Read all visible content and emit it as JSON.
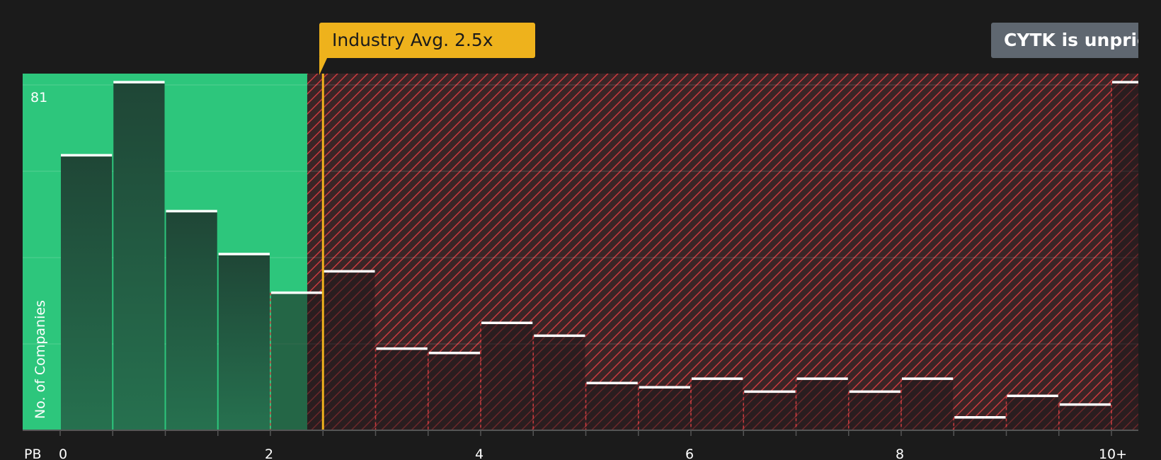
{
  "chart_data": {
    "type": "bar",
    "x_axis_label": "PB",
    "y_axis_label": "No. of Companies",
    "y_max_label": "81",
    "ylim": [
      0,
      83
    ],
    "grid": true,
    "x_tick_labels": [
      "0",
      "2",
      "4",
      "6",
      "8",
      "10+"
    ],
    "bin_width": 0.5,
    "bins": [
      {
        "x_start": 0.0,
        "value": 64
      },
      {
        "x_start": 0.5,
        "value": 81
      },
      {
        "x_start": 1.0,
        "value": 51
      },
      {
        "x_start": 1.5,
        "value": 41
      },
      {
        "x_start": 2.0,
        "value": 32
      },
      {
        "x_start": 2.5,
        "value": 37
      },
      {
        "x_start": 3.0,
        "value": 19
      },
      {
        "x_start": 3.5,
        "value": 18
      },
      {
        "x_start": 4.0,
        "value": 25
      },
      {
        "x_start": 4.5,
        "value": 22
      },
      {
        "x_start": 5.0,
        "value": 11
      },
      {
        "x_start": 5.5,
        "value": 10
      },
      {
        "x_start": 6.0,
        "value": 12
      },
      {
        "x_start": 6.5,
        "value": 9
      },
      {
        "x_start": 7.0,
        "value": 12
      },
      {
        "x_start": 7.5,
        "value": 9
      },
      {
        "x_start": 8.0,
        "value": 12
      },
      {
        "x_start": 8.5,
        "value": 3
      },
      {
        "x_start": 9.0,
        "value": 8
      },
      {
        "x_start": 9.5,
        "value": 6
      },
      {
        "x_start": 10.0,
        "value": 81
      }
    ],
    "company_value": 2.35,
    "industry_average": 2.5,
    "industry_average_label": "Industry Avg. 2.5x",
    "status_label": "CYTK is unpriced",
    "colors": {
      "background": "#1b1b1b",
      "undervalued_zone": "#2dc67c",
      "overvalued_zone": "#3a2526",
      "hatch": "#c93a3e",
      "bar_in_green": "#1f4636",
      "bar_in_red": "#2b2223",
      "bar_cap": "#ffffff",
      "industry_line": "#eeb21c",
      "status_badge": "#5f6770"
    }
  }
}
